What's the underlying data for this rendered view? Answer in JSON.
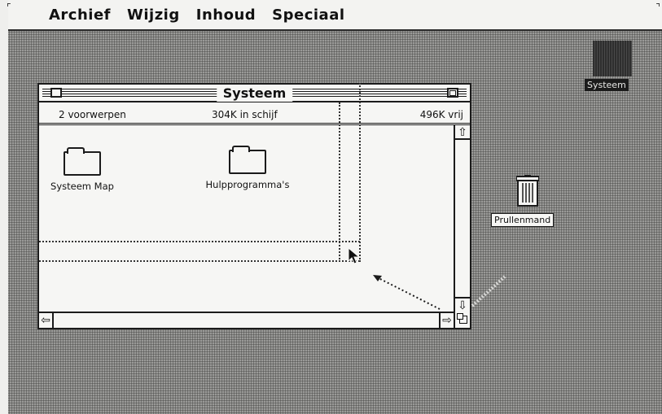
{
  "menubar": {
    "apple_glyph": "",
    "items": [
      "Archief",
      "Wijzig",
      "Inhoud",
      "Speciaal"
    ]
  },
  "window": {
    "title": "Systeem",
    "info": {
      "items_count": "2 voorwerpen",
      "disk_used": "304K in schijf",
      "free_space": "496K vrij"
    },
    "folders": [
      {
        "label": "Systeem Map"
      },
      {
        "label": "Hulpprogramma's"
      }
    ]
  },
  "desktop": {
    "disk_label": "Systeem",
    "trash_label": "Prullenmand"
  },
  "icons": [
    "apple-icon",
    "close-box-icon",
    "zoom-box-icon",
    "folder-icon",
    "disk-icon",
    "trash-icon",
    "scroll-arrow-icon",
    "grow-box-icon",
    "pointer-cursor-icon"
  ],
  "colors": {
    "ink": "#1b1b1b",
    "paper": "#f6f6f4",
    "desktop": "#8b8b89"
  }
}
